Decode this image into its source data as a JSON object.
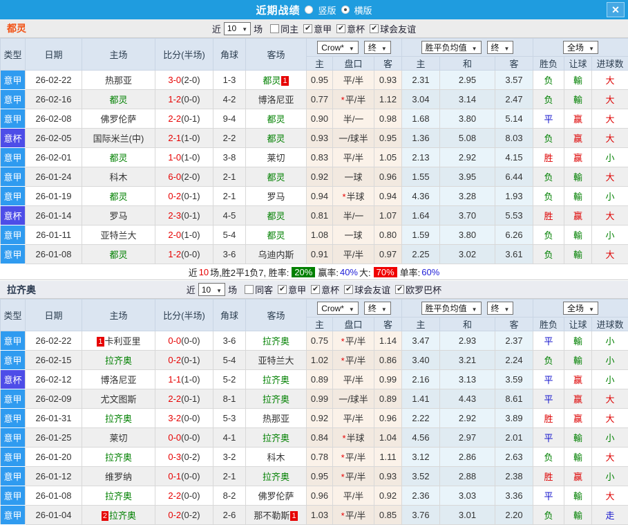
{
  "titlebar": {
    "title": "近期战绩",
    "radio_vertical": "竖版",
    "radio_horizontal": "横版",
    "close_icon": "✕"
  },
  "colors": {
    "titlebar_bg": "#1f9cdf",
    "league_serie_a": "#2f9bf0",
    "cup": "#4d4de8",
    "team_highlight": "#008000",
    "score_red": "#e60000",
    "badge_red": "#e60000",
    "win_rate_pill": "#008000",
    "big_rate_pill": "#f00000"
  },
  "value_colors": {
    "胜": "#dd0000",
    "平": "#1515cc",
    "负": "#008000",
    "赢": "#dd0000",
    "輸": "#008000",
    "大": "#dd0000",
    "小": "#008000",
    "走": "#1515cc"
  },
  "sections": [
    {
      "team": "都灵",
      "team_color": "#f25316",
      "controls": {
        "near_label": "近",
        "matches_value": "10",
        "matches_label": "场",
        "checkboxes": [
          {
            "label": "同主",
            "checked": false
          },
          {
            "label": "意甲",
            "checked": true
          },
          {
            "label": "意杯",
            "checked": true
          },
          {
            "label": "球会友谊",
            "checked": true
          }
        ]
      },
      "header": {
        "type": "类型",
        "date": "日期",
        "home": "主场",
        "score": "比分(半场)",
        "corner": "角球",
        "away": "客场",
        "odds_company": "Crow*",
        "odds_final": "终",
        "mean_label": "胜平负均值",
        "mean_final": "终",
        "scope_label": "全场",
        "sub_home": "主",
        "sub_handicap": "盘口",
        "sub_away": "客",
        "sub_mean_home": "主",
        "sub_mean_draw": "和",
        "sub_mean_away": "客",
        "sub_result": "胜负",
        "sub_spread": "让球",
        "sub_goals": "进球数"
      },
      "rows": [
        {
          "league": "意甲",
          "cup": false,
          "date": "26-02-22",
          "home": {
            "pre": "",
            "name": "热那亚",
            "team": false,
            "post": ""
          },
          "ft": "3-0",
          "ht": "(2-0)",
          "corner": "1-3",
          "away": {
            "pre": "",
            "name": "都灵",
            "team": true,
            "post": "1"
          },
          "o1": "0.95",
          "star": false,
          "hcp": "平/半",
          "o2": "0.93",
          "m1": "2.31",
          "m2": "2.95",
          "m3": "3.57",
          "r": "负",
          "s": "輸",
          "g": "大"
        },
        {
          "league": "意甲",
          "cup": false,
          "date": "26-02-16",
          "home": {
            "pre": "",
            "name": "都灵",
            "team": true,
            "post": ""
          },
          "ft": "1-2",
          "ht": "(0-0)",
          "corner": "4-2",
          "away": {
            "pre": "",
            "name": "博洛尼亚",
            "team": false,
            "post": ""
          },
          "o1": "0.77",
          "star": true,
          "hcp": "平/半",
          "o2": "1.12",
          "m1": "3.04",
          "m2": "3.14",
          "m3": "2.47",
          "r": "负",
          "s": "輸",
          "g": "大"
        },
        {
          "league": "意甲",
          "cup": false,
          "date": "26-02-08",
          "home": {
            "pre": "",
            "name": "佛罗伦萨",
            "team": false,
            "post": ""
          },
          "ft": "2-2",
          "ht": "(0-1)",
          "corner": "9-4",
          "away": {
            "pre": "",
            "name": "都灵",
            "team": true,
            "post": ""
          },
          "o1": "0.90",
          "star": false,
          "hcp": "半/一",
          "o2": "0.98",
          "m1": "1.68",
          "m2": "3.80",
          "m3": "5.14",
          "r": "平",
          "s": "赢",
          "g": "大"
        },
        {
          "league": "意杯",
          "cup": true,
          "date": "26-02-05",
          "home": {
            "pre": "",
            "name": "国际米兰(中)",
            "team": false,
            "post": ""
          },
          "ft": "2-1",
          "ht": "(1-0)",
          "corner": "2-2",
          "away": {
            "pre": "",
            "name": "都灵",
            "team": true,
            "post": ""
          },
          "o1": "0.93",
          "star": false,
          "hcp": "一/球半",
          "o2": "0.95",
          "m1": "1.36",
          "m2": "5.08",
          "m3": "8.03",
          "r": "负",
          "s": "赢",
          "g": "大"
        },
        {
          "league": "意甲",
          "cup": false,
          "date": "26-02-01",
          "home": {
            "pre": "",
            "name": "都灵",
            "team": true,
            "post": ""
          },
          "ft": "1-0",
          "ht": "(1-0)",
          "corner": "3-8",
          "away": {
            "pre": "",
            "name": "莱切",
            "team": false,
            "post": ""
          },
          "o1": "0.83",
          "star": false,
          "hcp": "平/半",
          "o2": "1.05",
          "m1": "2.13",
          "m2": "2.92",
          "m3": "4.15",
          "r": "胜",
          "s": "赢",
          "g": "小"
        },
        {
          "league": "意甲",
          "cup": false,
          "date": "26-01-24",
          "home": {
            "pre": "",
            "name": "科木",
            "team": false,
            "post": ""
          },
          "ft": "6-0",
          "ht": "(2-0)",
          "corner": "2-1",
          "away": {
            "pre": "",
            "name": "都灵",
            "team": true,
            "post": ""
          },
          "o1": "0.92",
          "star": false,
          "hcp": "一球",
          "o2": "0.96",
          "m1": "1.55",
          "m2": "3.95",
          "m3": "6.44",
          "r": "负",
          "s": "輸",
          "g": "大"
        },
        {
          "league": "意甲",
          "cup": false,
          "date": "26-01-19",
          "home": {
            "pre": "",
            "name": "都灵",
            "team": true,
            "post": ""
          },
          "ft": "0-2",
          "ht": "(0-1)",
          "corner": "2-1",
          "away": {
            "pre": "",
            "name": "罗马",
            "team": false,
            "post": ""
          },
          "o1": "0.94",
          "star": true,
          "hcp": "半球",
          "o2": "0.94",
          "m1": "4.36",
          "m2": "3.28",
          "m3": "1.93",
          "r": "负",
          "s": "輸",
          "g": "小"
        },
        {
          "league": "意杯",
          "cup": true,
          "date": "26-01-14",
          "home": {
            "pre": "",
            "name": "罗马",
            "team": false,
            "post": ""
          },
          "ft": "2-3",
          "ht": "(0-1)",
          "corner": "4-5",
          "away": {
            "pre": "",
            "name": "都灵",
            "team": true,
            "post": ""
          },
          "o1": "0.81",
          "star": false,
          "hcp": "半/一",
          "o2": "1.07",
          "m1": "1.64",
          "m2": "3.70",
          "m3": "5.53",
          "r": "胜",
          "s": "赢",
          "g": "大"
        },
        {
          "league": "意甲",
          "cup": false,
          "date": "26-01-11",
          "home": {
            "pre": "",
            "name": "亚特兰大",
            "team": false,
            "post": ""
          },
          "ft": "2-0",
          "ht": "(1-0)",
          "corner": "5-4",
          "away": {
            "pre": "",
            "name": "都灵",
            "team": true,
            "post": ""
          },
          "o1": "1.08",
          "star": false,
          "hcp": "一球",
          "o2": "0.80",
          "m1": "1.59",
          "m2": "3.80",
          "m3": "6.26",
          "r": "负",
          "s": "輸",
          "g": "小"
        },
        {
          "league": "意甲",
          "cup": false,
          "date": "26-01-08",
          "home": {
            "pre": "",
            "name": "都灵",
            "team": true,
            "post": ""
          },
          "ft": "1-2",
          "ht": "(0-0)",
          "corner": "3-6",
          "away": {
            "pre": "",
            "name": "乌迪内斯",
            "team": false,
            "post": ""
          },
          "o1": "0.91",
          "star": false,
          "hcp": "平/半",
          "o2": "0.97",
          "m1": "2.25",
          "m2": "3.02",
          "m3": "3.61",
          "r": "负",
          "s": "輸",
          "g": "大"
        }
      ],
      "summary": {
        "prefix": "近",
        "count": "10",
        "stats": "场,胜2平1负7, 胜率:",
        "win_rate": "20%",
        "win_odds_label": "赢率:",
        "win_odds": "40%",
        "big_label": "大:",
        "big_rate": "70%",
        "single_label": "单率:",
        "single_rate": "60%"
      }
    },
    {
      "team": "拉齐奥",
      "team_color": "#2b3a50",
      "controls": {
        "near_label": "近",
        "matches_value": "10",
        "matches_label": "场",
        "checkboxes": [
          {
            "label": "同客",
            "checked": false
          },
          {
            "label": "意甲",
            "checked": true
          },
          {
            "label": "意杯",
            "checked": true
          },
          {
            "label": "球会友谊",
            "checked": true
          },
          {
            "label": "欧罗巴杯",
            "checked": true
          }
        ]
      },
      "header": {
        "type": "类型",
        "date": "日期",
        "home": "主场",
        "score": "比分(半场)",
        "corner": "角球",
        "away": "客场",
        "odds_company": "Crow*",
        "odds_final": "终",
        "mean_label": "胜平负均值",
        "mean_final": "终",
        "scope_label": "全场",
        "sub_home": "主",
        "sub_handicap": "盘口",
        "sub_away": "客",
        "sub_mean_home": "主",
        "sub_mean_draw": "和",
        "sub_mean_away": "客",
        "sub_result": "胜负",
        "sub_spread": "让球",
        "sub_goals": "进球数"
      },
      "rows": [
        {
          "league": "意甲",
          "cup": false,
          "date": "26-02-22",
          "home": {
            "pre": "1",
            "name": "卡利亚里",
            "team": false,
            "post": ""
          },
          "ft": "0-0",
          "ht": "(0-0)",
          "corner": "3-6",
          "away": {
            "pre": "",
            "name": "拉齐奥",
            "team": true,
            "post": ""
          },
          "o1": "0.75",
          "star": true,
          "hcp": "平/半",
          "o2": "1.14",
          "m1": "3.47",
          "m2": "2.93",
          "m3": "2.37",
          "r": "平",
          "s": "輸",
          "g": "小"
        },
        {
          "league": "意甲",
          "cup": false,
          "date": "26-02-15",
          "home": {
            "pre": "",
            "name": "拉齐奥",
            "team": true,
            "post": ""
          },
          "ft": "0-2",
          "ht": "(0-1)",
          "corner": "5-4",
          "away": {
            "pre": "",
            "name": "亚特兰大",
            "team": false,
            "post": ""
          },
          "o1": "1.02",
          "star": true,
          "hcp": "平/半",
          "o2": "0.86",
          "m1": "3.40",
          "m2": "3.21",
          "m3": "2.24",
          "r": "负",
          "s": "輸",
          "g": "小"
        },
        {
          "league": "意杯",
          "cup": true,
          "date": "26-02-12",
          "home": {
            "pre": "",
            "name": "博洛尼亚",
            "team": false,
            "post": ""
          },
          "ft": "1-1",
          "ht": "(1-0)",
          "corner": "5-2",
          "away": {
            "pre": "",
            "name": "拉齐奥",
            "team": true,
            "post": ""
          },
          "o1": "0.89",
          "star": false,
          "hcp": "平/半",
          "o2": "0.99",
          "m1": "2.16",
          "m2": "3.13",
          "m3": "3.59",
          "r": "平",
          "s": "赢",
          "g": "小"
        },
        {
          "league": "意甲",
          "cup": false,
          "date": "26-02-09",
          "home": {
            "pre": "",
            "name": "尤文图斯",
            "team": false,
            "post": ""
          },
          "ft": "2-2",
          "ht": "(0-1)",
          "corner": "8-1",
          "away": {
            "pre": "",
            "name": "拉齐奥",
            "team": true,
            "post": ""
          },
          "o1": "0.99",
          "star": false,
          "hcp": "一/球半",
          "o2": "0.89",
          "m1": "1.41",
          "m2": "4.43",
          "m3": "8.61",
          "r": "平",
          "s": "赢",
          "g": "大"
        },
        {
          "league": "意甲",
          "cup": false,
          "date": "26-01-31",
          "home": {
            "pre": "",
            "name": "拉齐奥",
            "team": true,
            "post": ""
          },
          "ft": "3-2",
          "ht": "(0-0)",
          "corner": "5-3",
          "away": {
            "pre": "",
            "name": "热那亚",
            "team": false,
            "post": ""
          },
          "o1": "0.92",
          "star": false,
          "hcp": "平/半",
          "o2": "0.96",
          "m1": "2.22",
          "m2": "2.92",
          "m3": "3.89",
          "r": "胜",
          "s": "赢",
          "g": "大"
        },
        {
          "league": "意甲",
          "cup": false,
          "date": "26-01-25",
          "home": {
            "pre": "",
            "name": "莱切",
            "team": false,
            "post": ""
          },
          "ft": "0-0",
          "ht": "(0-0)",
          "corner": "4-1",
          "away": {
            "pre": "",
            "name": "拉齐奥",
            "team": true,
            "post": ""
          },
          "o1": "0.84",
          "star": true,
          "hcp": "半球",
          "o2": "1.04",
          "m1": "4.56",
          "m2": "2.97",
          "m3": "2.01",
          "r": "平",
          "s": "輸",
          "g": "小"
        },
        {
          "league": "意甲",
          "cup": false,
          "date": "26-01-20",
          "home": {
            "pre": "",
            "name": "拉齐奥",
            "team": true,
            "post": ""
          },
          "ft": "0-3",
          "ht": "(0-2)",
          "corner": "3-2",
          "away": {
            "pre": "",
            "name": "科木",
            "team": false,
            "post": ""
          },
          "o1": "0.78",
          "star": true,
          "hcp": "平/半",
          "o2": "1.11",
          "m1": "3.12",
          "m2": "2.86",
          "m3": "2.63",
          "r": "负",
          "s": "輸",
          "g": "大"
        },
        {
          "league": "意甲",
          "cup": false,
          "date": "26-01-12",
          "home": {
            "pre": "",
            "name": "维罗纳",
            "team": false,
            "post": ""
          },
          "ft": "0-1",
          "ht": "(0-0)",
          "corner": "2-1",
          "away": {
            "pre": "",
            "name": "拉齐奥",
            "team": true,
            "post": ""
          },
          "o1": "0.95",
          "star": true,
          "hcp": "平/半",
          "o2": "0.93",
          "m1": "3.52",
          "m2": "2.88",
          "m3": "2.38",
          "r": "胜",
          "s": "赢",
          "g": "小"
        },
        {
          "league": "意甲",
          "cup": false,
          "date": "26-01-08",
          "home": {
            "pre": "",
            "name": "拉齐奥",
            "team": true,
            "post": ""
          },
          "ft": "2-2",
          "ht": "(0-0)",
          "corner": "8-2",
          "away": {
            "pre": "",
            "name": "佛罗伦萨",
            "team": false,
            "post": ""
          },
          "o1": "0.96",
          "star": false,
          "hcp": "平/半",
          "o2": "0.92",
          "m1": "2.36",
          "m2": "3.03",
          "m3": "3.36",
          "r": "平",
          "s": "輸",
          "g": "大"
        },
        {
          "league": "意甲",
          "cup": false,
          "date": "26-01-04",
          "home": {
            "pre": "2",
            "name": "拉齐奥",
            "team": true,
            "post": ""
          },
          "ft": "0-2",
          "ht": "(0-2)",
          "corner": "2-6",
          "away": {
            "pre": "",
            "name": "那不勒斯",
            "team": false,
            "post": "1"
          },
          "o1": "1.03",
          "star": true,
          "hcp": "平/半",
          "o2": "0.85",
          "m1": "3.76",
          "m2": "3.01",
          "m3": "2.20",
          "r": "负",
          "s": "輸",
          "g": "走"
        }
      ]
    }
  ]
}
